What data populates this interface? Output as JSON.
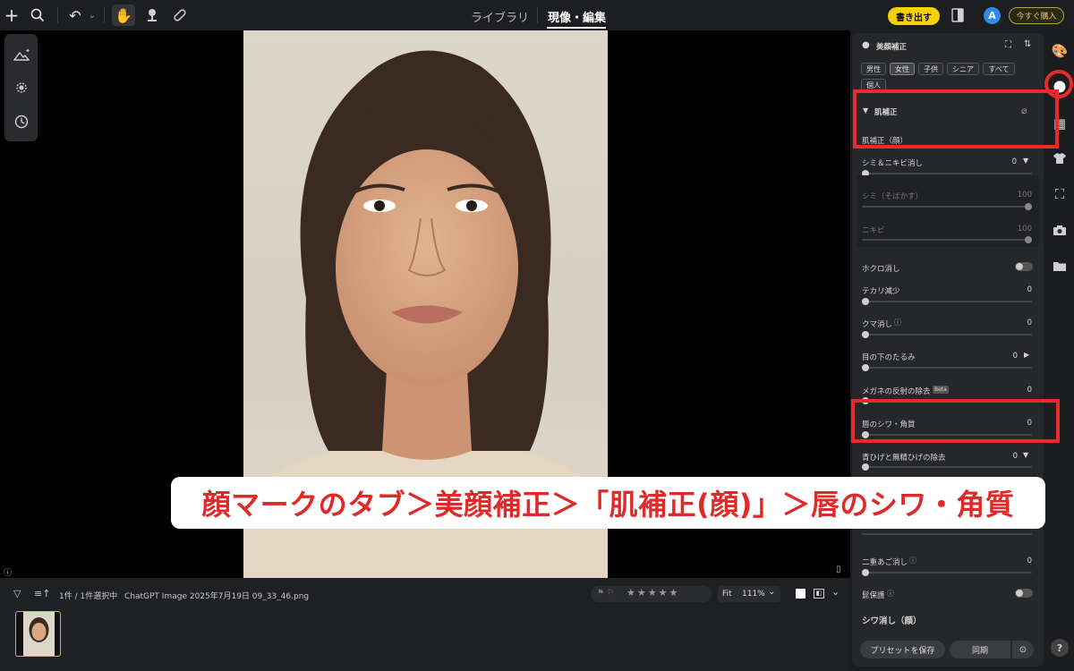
{
  "topbar": {
    "tabs": [
      "ライブラリ",
      "現像・編集"
    ],
    "export_label": "書き出す",
    "avatar_letter": "A",
    "buy_label": "今すぐ購入"
  },
  "bottom": {
    "selection": "1件 / 1件選択中",
    "filename": "ChatGPT Image 2025年7月19日 09_33_46.png",
    "fit_label": "Fit",
    "zoom": "111%"
  },
  "panel": {
    "title": "美顔補正",
    "chips": [
      "男性",
      "女性",
      "子供",
      "シニア",
      "すべて",
      "個人"
    ],
    "section": "肌補正",
    "subsection": "肌補正（顔）",
    "rows": [
      {
        "label": "シミ＆ニキビ消し",
        "value": "0"
      },
      {
        "label": "シミ（そばかす）",
        "value": "100"
      },
      {
        "label": "ニキビ",
        "value": "100"
      },
      {
        "label": "ホクロ消し"
      },
      {
        "label": "テカリ減少",
        "value": "0"
      },
      {
        "label": "クマ消し",
        "value": "0"
      },
      {
        "label": "目の下のたるみ",
        "value": "0"
      },
      {
        "label": "メガネの反射の除去",
        "badge": "Beta",
        "value": "0"
      },
      {
        "label": "唇のシワ・角質",
        "value": "0"
      },
      {
        "label": "青ひげと無精ひげの除去",
        "value": "0"
      },
      {
        "label": "二重あご消し",
        "value": "0"
      },
      {
        "label": "髭保護"
      },
      {
        "label": "シワ消し（顔）"
      }
    ],
    "save_preset": "プリセットを保存",
    "sync": "同期"
  },
  "caption": "顔マークのタブ＞美顔補正＞「肌補正(顔)」＞唇のシワ・角質",
  "colors": {
    "accent": "#f5d10a",
    "highlight": "#e82a2a",
    "panel": "#26272b"
  }
}
